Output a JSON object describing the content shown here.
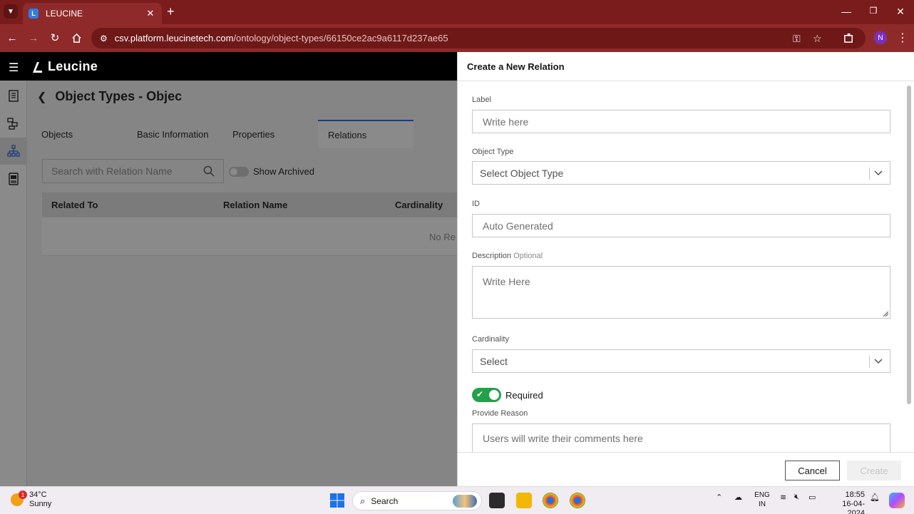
{
  "browser": {
    "tab_title": "LEUCINE",
    "url_host": "csv.platform.leucinetech.com",
    "url_path": "/ontology/object-types/66150ce2ac9a6117d237ae65",
    "profile_initial": "N"
  },
  "app": {
    "brand": "Leucine",
    "page_title": "Object Types - Objec",
    "tabs": [
      "Objects",
      "Basic Information",
      "Properties",
      "Relations"
    ],
    "active_tab": "Relations",
    "search_placeholder": "Search with Relation Name",
    "show_archived_label": "Show Archived",
    "table_headers": [
      "Related To",
      "Relation Name",
      "Cardinality"
    ],
    "empty_text": "No Re"
  },
  "drawer": {
    "title": "Create a New Relation",
    "label_field": {
      "label": "Label",
      "placeholder": "Write here"
    },
    "object_type_field": {
      "label": "Object Type",
      "placeholder": "Select Object Type"
    },
    "id_field": {
      "label": "ID",
      "value": "Auto Generated"
    },
    "description_field": {
      "label": "Description",
      "optional": "Optional",
      "placeholder": "Write Here"
    },
    "cardinality_field": {
      "label": "Cardinality",
      "placeholder": "Select"
    },
    "required_label": "Required",
    "reason_field": {
      "label": "Provide Reason",
      "placeholder": "Users will write their comments here"
    },
    "cancel_label": "Cancel",
    "create_label": "Create"
  },
  "taskbar": {
    "temperature": "34°C",
    "weather": "Sunny",
    "notification_count": "1",
    "search_label": "Search",
    "lang_line1": "ENG",
    "lang_line2": "IN",
    "time": "18:55",
    "date": "16-04-2024"
  },
  "colors": {
    "browser_chrome": "#8f2a2a",
    "tab_strip": "#7a1c1c",
    "accent_blue": "#1f62e0",
    "toggle_green": "#24a148"
  }
}
